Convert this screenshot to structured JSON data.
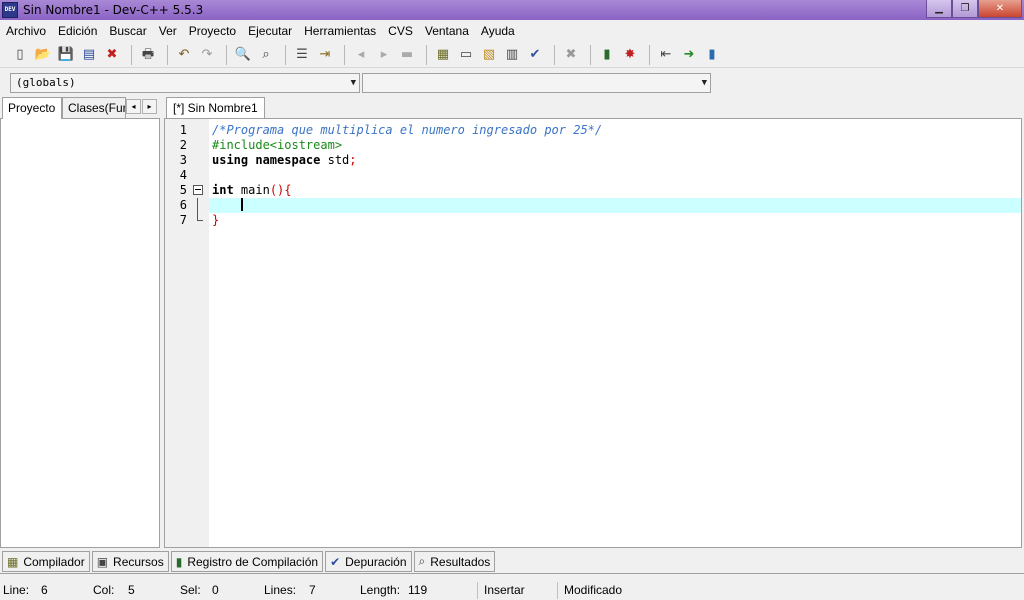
{
  "window": {
    "title": "Sin Nombre1 - Dev-C++ 5.5.3",
    "icon_label": "DEV",
    "minimize_glyph": "▁",
    "maximize_glyph": "❐",
    "close_glyph": "✕"
  },
  "menu": [
    "Archivo",
    "Edición",
    "Buscar",
    "Ver",
    "Proyecto",
    "Ejecutar",
    "Herramientas",
    "CVS",
    "Ventana",
    "Ayuda"
  ],
  "toolbar": [
    {
      "name": "new-file-icon",
      "glyph": "▯",
      "color": "#444444"
    },
    {
      "name": "open-file-icon",
      "glyph": "📂",
      "color": "#c08a20"
    },
    {
      "name": "save-icon",
      "glyph": "💾",
      "color": "#2a4a9a"
    },
    {
      "name": "save-all-icon",
      "glyph": "▤",
      "color": "#2a4a9a"
    },
    {
      "name": "close-file-icon",
      "glyph": "✖",
      "color": "#c02020"
    },
    {
      "sep": true
    },
    {
      "name": "print-icon",
      "glyph": "🖶",
      "color": "#444444"
    },
    {
      "sep": true
    },
    {
      "name": "undo-icon",
      "glyph": "↶",
      "color": "#7a5a20"
    },
    {
      "name": "redo-icon",
      "glyph": "↷",
      "color": "#999999"
    },
    {
      "sep": true
    },
    {
      "name": "find-icon",
      "glyph": "🔍",
      "color": "#444444"
    },
    {
      "name": "replace-icon",
      "glyph": "⌕",
      "color": "#444444"
    },
    {
      "sep": true
    },
    {
      "name": "goto-line-icon",
      "glyph": "☰",
      "color": "#444444"
    },
    {
      "name": "toggle-bookmark-icon",
      "glyph": "⇥",
      "color": "#8a6a20"
    },
    {
      "sep": true
    },
    {
      "name": "indent-left-icon",
      "glyph": "◂",
      "color": "#aaaaaa"
    },
    {
      "name": "indent-right-icon",
      "glyph": "▸",
      "color": "#aaaaaa"
    },
    {
      "name": "comment-icon",
      "glyph": "▬",
      "color": "#aaaaaa"
    },
    {
      "sep": true
    },
    {
      "name": "compile-icon",
      "glyph": "▦",
      "color": "#6a6a20"
    },
    {
      "name": "run-icon",
      "glyph": "▭",
      "color": "#444444"
    },
    {
      "name": "compile-run-icon",
      "glyph": "▧",
      "color": "#c08a20"
    },
    {
      "name": "rebuild-icon",
      "glyph": "▥",
      "color": "#444444"
    },
    {
      "name": "syntax-check-icon",
      "glyph": "✔",
      "color": "#3050a0"
    },
    {
      "sep": true
    },
    {
      "name": "stop-icon",
      "glyph": "✖",
      "color": "#999999"
    },
    {
      "sep": true
    },
    {
      "name": "profile-icon",
      "glyph": "▮",
      "color": "#2a6a2a"
    },
    {
      "name": "delete-profile-icon",
      "glyph": "✸",
      "color": "#c02020"
    },
    {
      "sep": true
    },
    {
      "name": "insert-icon",
      "glyph": "⇤",
      "color": "#444444"
    },
    {
      "name": "exit-icon",
      "glyph": "➜",
      "color": "#2a8a2a"
    },
    {
      "name": "bookmark-icon",
      "glyph": "▮",
      "color": "#2a6ab0"
    }
  ],
  "combos": {
    "scope": "(globals)",
    "member": "",
    "arrow": "▼"
  },
  "left_tabs": {
    "project": "Proyecto",
    "classes": "Clases(Fun",
    "arrow_left": "◂",
    "arrow_right": "▸"
  },
  "editor": {
    "tab_label": "[*] Sin Nombre1",
    "lines": [
      {
        "num": "1",
        "fold": "",
        "segments": [
          {
            "t": "/*Programa que multiplica el numero ingresado por 25*/",
            "c": "c-comment"
          }
        ]
      },
      {
        "num": "2",
        "fold": "",
        "segments": [
          {
            "t": "#include<iostream>",
            "c": "c-pre"
          }
        ]
      },
      {
        "num": "3",
        "fold": "",
        "segments": [
          {
            "t": "using namespace",
            "c": "c-kw"
          },
          {
            "t": " std",
            "c": "c-plain"
          },
          {
            "t": ";",
            "c": "c-sym"
          }
        ]
      },
      {
        "num": "4",
        "fold": "",
        "segments": []
      },
      {
        "num": "5",
        "fold": "box",
        "segments": [
          {
            "t": "int",
            "c": "c-kw"
          },
          {
            "t": " main",
            "c": "c-plain"
          },
          {
            "t": "(){",
            "c": "c-sym"
          }
        ]
      },
      {
        "num": "6",
        "fold": "line",
        "highlight": true,
        "cursor": true,
        "segments": [
          {
            "t": "    ",
            "c": "c-plain"
          }
        ]
      },
      {
        "num": "7",
        "fold": "end",
        "segments": [
          {
            "t": "}",
            "c": "c-sym"
          }
        ]
      }
    ]
  },
  "bottom_tabs": [
    {
      "label": "Compilador",
      "icon": "compiler-icon",
      "glyph": "▦",
      "color": "#6a6a20"
    },
    {
      "label": "Recursos",
      "icon": "resources-icon",
      "glyph": "▣",
      "color": "#444444"
    },
    {
      "label": "Registro de Compilación",
      "icon": "compile-log-icon",
      "glyph": "▮",
      "color": "#2a6a2a"
    },
    {
      "label": "Depuración",
      "icon": "debug-icon",
      "glyph": "✔",
      "color": "#3050a0"
    },
    {
      "label": "Resultados",
      "icon": "results-icon",
      "glyph": "⌕",
      "color": "#444444"
    }
  ],
  "status": {
    "line_label": "Line:",
    "line_value": "6",
    "col_label": "Col:",
    "col_value": "5",
    "sel_label": "Sel:",
    "sel_value": "0",
    "lines_label": "Lines:",
    "lines_value": "7",
    "length_label": "Length:",
    "length_value": "119",
    "mode": "Insertar",
    "state": "Modificado"
  }
}
